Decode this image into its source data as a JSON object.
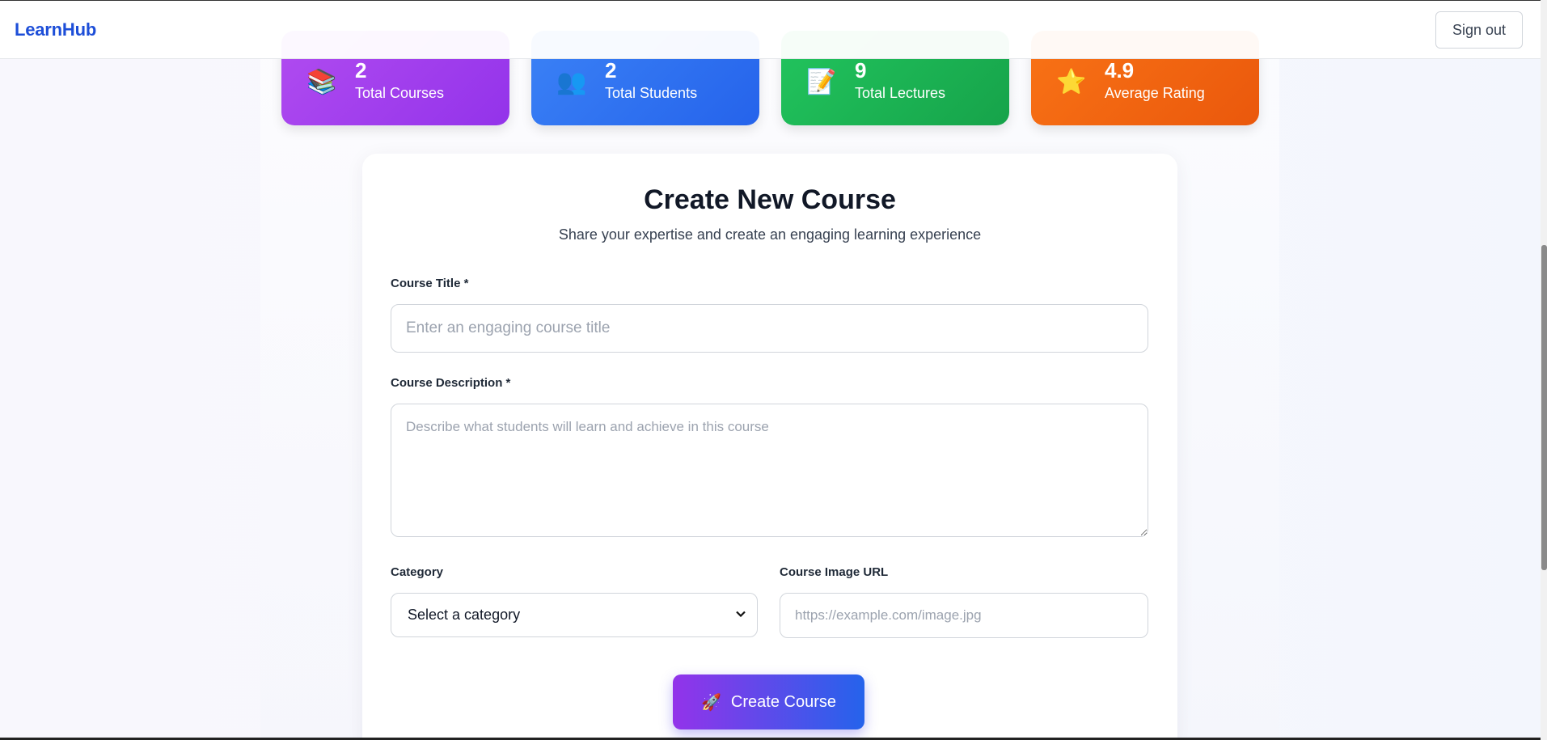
{
  "header": {
    "brand": "LearnHub",
    "sign_out_label": "Sign out"
  },
  "stats": [
    {
      "value": "2",
      "label": "Total Courses",
      "icon": "books-icon",
      "glyph": "📚",
      "color": "#9333ea"
    },
    {
      "value": "2",
      "label": "Total Students",
      "icon": "students-icon",
      "glyph": "👥",
      "color": "#2563eb"
    },
    {
      "value": "9",
      "label": "Total Lectures",
      "icon": "memo-icon",
      "glyph": "📝",
      "color": "#16a34a"
    },
    {
      "value": "4.9",
      "label": "Average Rating",
      "icon": "star-icon",
      "glyph": "⭐",
      "color": "#ea580c"
    }
  ],
  "form": {
    "title": "Create New Course",
    "subtitle": "Share your expertise and create an engaging learning experience",
    "course_title_label": "Course Title *",
    "course_title_placeholder": "Enter an engaging course title",
    "course_title_value": "",
    "description_label": "Course Description *",
    "description_placeholder": "Describe what students will learn and achieve in this course",
    "description_value": "",
    "category_label": "Category",
    "category_selected": "Select a category",
    "image_url_label": "Course Image URL",
    "image_url_placeholder": "https://example.com/image.jpg",
    "image_url_value": "",
    "submit_icon": "rocket-icon",
    "submit_glyph": "🚀",
    "submit_label": "Create Course"
  }
}
